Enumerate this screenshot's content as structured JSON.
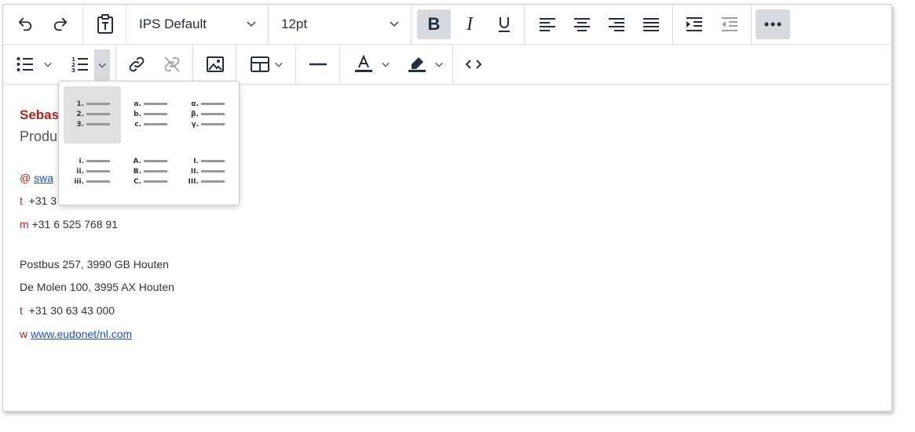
{
  "toolbar": {
    "undo_icon": "undo-icon",
    "redo_icon": "redo-icon",
    "paste_icon": "paste-as-text-icon",
    "font_family": "IPS Default",
    "font_size": "12pt",
    "bold_active": true,
    "more_active": true
  },
  "list_dropdown": {
    "options": [
      {
        "labels": [
          "1.",
          "2.",
          "3."
        ],
        "selected": true
      },
      {
        "labels": [
          "a.",
          "b.",
          "c."
        ],
        "selected": false
      },
      {
        "labels": [
          "α.",
          "β.",
          "γ."
        ],
        "selected": false
      },
      {
        "labels": [
          "i.",
          "ii.",
          "iii."
        ],
        "selected": false
      },
      {
        "labels": [
          "A.",
          "B.",
          "C."
        ],
        "selected": false
      },
      {
        "labels": [
          "I.",
          "II.",
          "III."
        ],
        "selected": false
      }
    ]
  },
  "signature": {
    "name": "Sebas",
    "role": "Produ",
    "email_prefix": "@",
    "email": "swa",
    "tel_prefix": "t",
    "tel": "+31 3",
    "mobile_prefix": "m",
    "mobile": "+31 6 525 768 91",
    "address1": "Postbus 257, 3990 GB Houten",
    "address2": "De Molen 100, 3995 AX Houten",
    "office_tel_prefix": "t",
    "office_tel": "+31 30 63 43 000",
    "web_prefix": "w",
    "web": "www.eudonet/nl.com"
  },
  "colors": {
    "accent_red": "#b21f1f",
    "link_blue": "#1f4fd1",
    "active_bg": "#d6d9de"
  }
}
